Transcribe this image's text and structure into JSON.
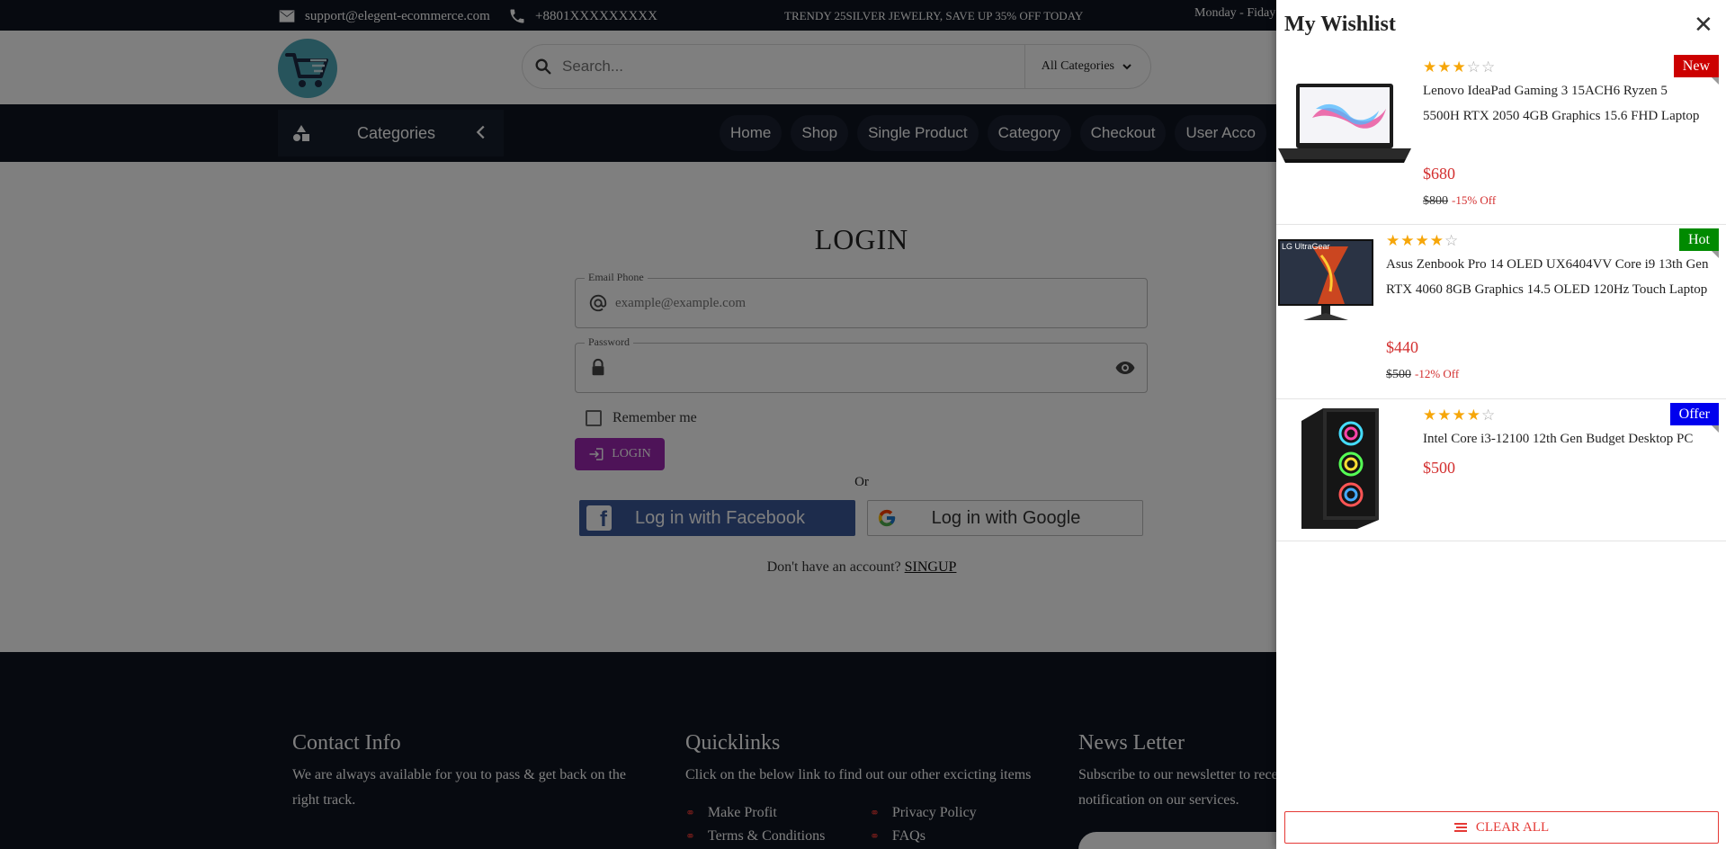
{
  "topbar": {
    "email": "support@elegent-ecommerce.com",
    "phone": "+8801XXXXXXXXX",
    "promo": "TRENDY 25SILVER JEWELRY, SAVE UP 35% OFF TODAY",
    "hours": "Monday - Fiday"
  },
  "header": {
    "search_placeholder": "Search...",
    "category_select": "All Categories"
  },
  "nav": {
    "categories_label": "Categories",
    "links": [
      "Home",
      "Shop",
      "Single Product",
      "Category",
      "Checkout",
      "User Acco"
    ]
  },
  "login": {
    "title": "LOGIN",
    "email_label": "Email Phone",
    "email_placeholder": "example@example.com",
    "password_label": "Password",
    "remember_label": "Remember me",
    "login_button": "LOGIN",
    "or_text": "Or",
    "facebook_button": "Log in with Facebook",
    "google_button": "Log in with Google",
    "signup_prompt": "Don't have an account?",
    "signup_link": "SINGUP"
  },
  "footer": {
    "contact": {
      "title": "Contact Info",
      "text": "We are always available for you to pass & get back on the right track."
    },
    "quicklinks": {
      "title": "Quicklinks",
      "text": "Click on the below link to find out our other excicting items",
      "links": [
        "Make Profit",
        "Privacy Policy",
        "Terms & Conditions",
        "FAQs"
      ]
    },
    "newsletter": {
      "title": "News Letter",
      "text": "Subscribe to our newsletter to rece notification on our services."
    }
  },
  "wishlist": {
    "title": "My Wishlist",
    "close_icon": "close-icon",
    "clear_all": "CLEAR ALL",
    "items": [
      {
        "name": "Lenovo IdeaPad Gaming 3 15ACH6 Ryzen 5 5500H RTX 2050 4GB Graphics 15.6 FHD Laptop",
        "price": "$680",
        "old_price": "$800",
        "discount": "-15% Off",
        "rating": 3,
        "badge": "New",
        "badge_color": "#cc0000"
      },
      {
        "name": "Asus Zenbook Pro 14 OLED UX6404VV Core i9 13th Gen RTX 4060 8GB Graphics 14.5 OLED 120Hz Touch Laptop",
        "price": "$440",
        "old_price": "$500",
        "discount": "-12% Off",
        "rating": 4,
        "badge": "Hot",
        "badge_color": "#008a00",
        "image_text": "LG UltraGear"
      },
      {
        "name": "Intel Core i3-12100 12th Gen Budget Desktop PC",
        "price": "$500",
        "rating": 4,
        "badge": "Offer",
        "badge_color": "#0000ee"
      }
    ]
  },
  "colors": {
    "dark": "#0f1521",
    "login_button": "#9c27b0",
    "facebook": "#3b5998",
    "price": "#d32f2f",
    "star": "#f6a609"
  }
}
